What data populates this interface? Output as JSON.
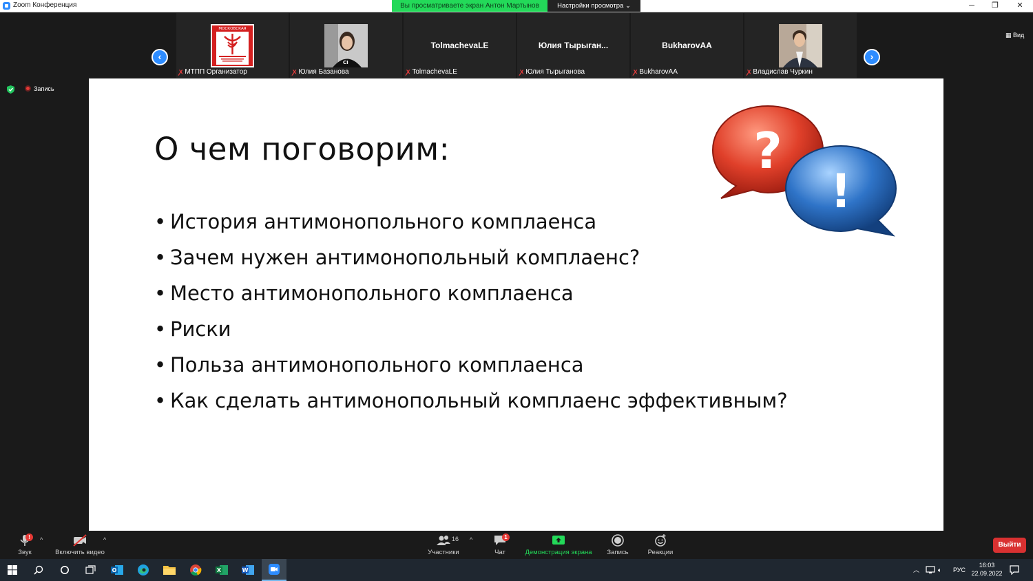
{
  "window": {
    "title": "Zoom Конференция",
    "minimize": "─",
    "restore": "❐",
    "close": "✕"
  },
  "share": {
    "banner": "Вы просматриваете экран Антон Мартынов",
    "view_options": "Настройки просмотра ⌄"
  },
  "participants_strip": [
    {
      "label": "МТПП Организатор",
      "type": "logo",
      "logo_text": "МОСКОВСКАЯ"
    },
    {
      "label": "Юлия Базанова",
      "type": "photo-woman"
    },
    {
      "label": "TolmachevaLE",
      "type": "name",
      "name": "TolmachevaLE"
    },
    {
      "label": "Юлия Тырыганова",
      "type": "name",
      "name": "Юлия  Тырыган..."
    },
    {
      "label": "BukharovAA",
      "type": "name",
      "name": "BukharovAA"
    },
    {
      "label": "Владислав Чуркин",
      "type": "photo-man"
    }
  ],
  "view_button": "Вид",
  "recording_indicator": "Запись",
  "slide": {
    "title": "О чем поговорим:",
    "bullets": [
      "История антимонопольного комплаенса",
      "Зачем нужен антимонопольный комплаенс?",
      "Место антимонопольного комплаенса",
      "Риски",
      "Польза антимонопольного комплаенса",
      "Как сделать антимонопольный комплаенс эффективным?"
    ],
    "bubble_question": "?",
    "bubble_exclaim": "!"
  },
  "toolbar": {
    "audio": "Звук",
    "audio_badge": "!",
    "video": "Включить видео",
    "participants": "Участники",
    "participants_count": "16",
    "chat": "Чат",
    "chat_badge": "1",
    "share_screen": "Демонстрация экрана",
    "record": "Запись",
    "reactions": "Реакции",
    "leave": "Выйти"
  },
  "taskbar": {
    "language": "РУС",
    "time": "16:03",
    "date": "22.09.2022"
  },
  "colors": {
    "zoom_blue": "#2d8cff",
    "share_green": "#23d959",
    "leave_red": "#d93131",
    "bubble_red": "#e0402a",
    "bubble_blue": "#2f74c8"
  }
}
